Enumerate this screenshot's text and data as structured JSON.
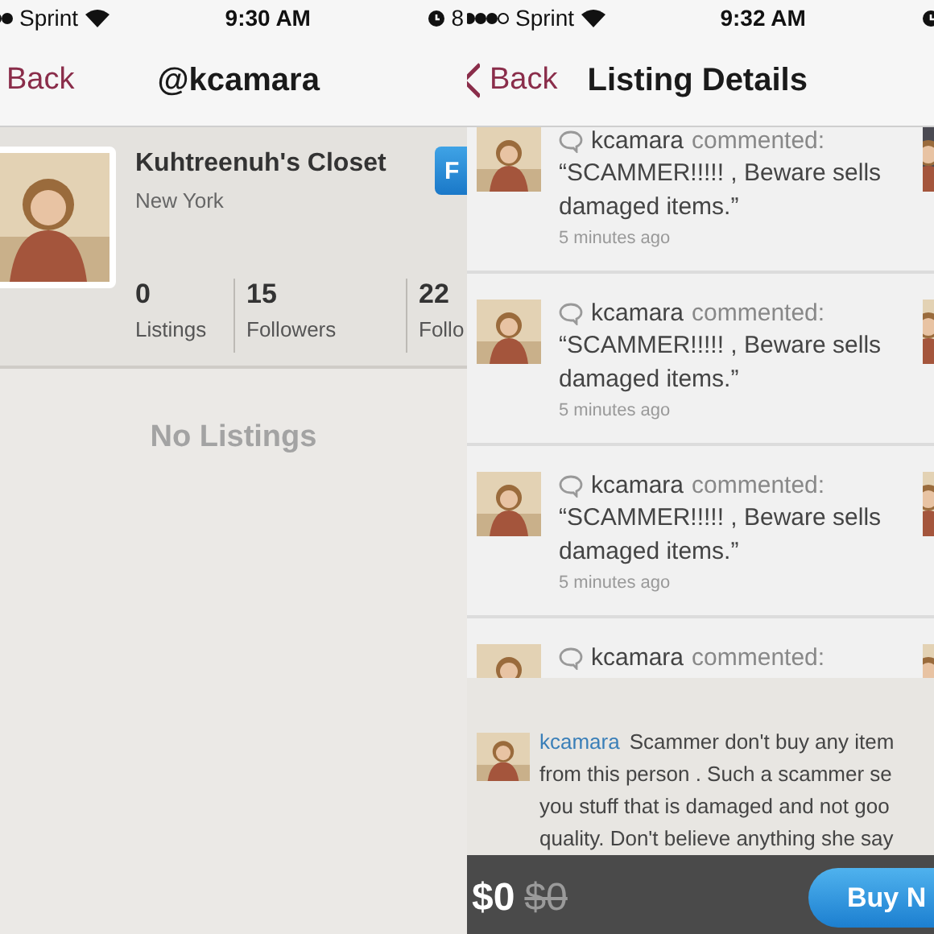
{
  "profile_screen": {
    "status_bar": {
      "carrier": "Sprint",
      "time": "9:30 AM",
      "battery": "8"
    },
    "nav": {
      "back": "Back",
      "title": "@kcamara"
    },
    "profile": {
      "name": "Kuhtreenuh's Closet",
      "location": "New York",
      "follow_button": "F",
      "stats": [
        {
          "value": "0",
          "label": "Listings"
        },
        {
          "value": "15",
          "label": "Followers"
        },
        {
          "value": "22",
          "label": "Follo"
        }
      ]
    },
    "empty_message": "No Listings"
  },
  "listing_screen": {
    "status_bar": {
      "carrier": "Sprint",
      "time": "9:32 AM"
    },
    "nav": {
      "back": "Back",
      "title": "Listing Details"
    },
    "activity": [
      {
        "user": "kcamara",
        "action": "commented:",
        "quote": "“SCAMMER!!!!! , Beware sells damaged items.”",
        "time": "5 minutes ago"
      },
      {
        "user": "kcamara",
        "action": "commented:",
        "quote": "“SCAMMER!!!!! , Beware sells damaged items.”",
        "time": "5 minutes ago"
      },
      {
        "user": "kcamara",
        "action": "commented:",
        "quote": "“SCAMMER!!!!! , Beware sells damaged items.”",
        "time": "5 minutes ago"
      },
      {
        "user": "kcamara",
        "action": "commented:"
      }
    ],
    "comment": {
      "user": "kcamara",
      "lines": [
        "Scammer don't buy any item",
        "from this person . Such a scammer se",
        "you stuff that is damaged and not goo",
        "quality. Don't believe anything she say"
      ]
    },
    "price": "$0",
    "original_price": "$0",
    "buy_button": "Buy N"
  }
}
